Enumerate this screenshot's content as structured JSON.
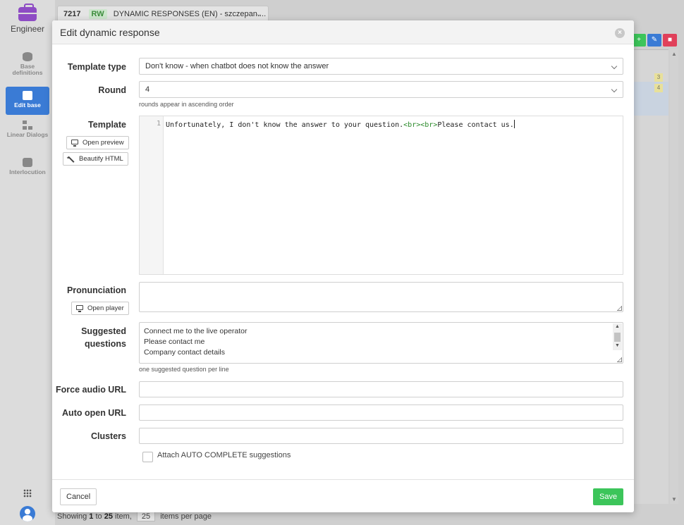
{
  "app": {
    "name": "Engineer",
    "accent": "#3a7bd5",
    "brand_color": "#8e4cc4"
  },
  "sidebar": {
    "items": [
      {
        "label": "Base definitions",
        "icon": "database-icon"
      },
      {
        "label": "Edit base",
        "icon": "table-icon",
        "active": true
      },
      {
        "label": "Linear Dialogs",
        "icon": "flow-icon"
      },
      {
        "label": "Interlocution",
        "icon": "chat-bubble-icon"
      }
    ],
    "bottom_icons": [
      "apps-grid-icon",
      "user-avatar-icon"
    ]
  },
  "background": {
    "base_id": "7217",
    "access": "RW",
    "base_title": "DYNAMIC RESPONSES (EN) - szczepan....",
    "row_badges": [
      "3",
      "4"
    ],
    "pagination": {
      "prefix": "Showing",
      "from": "1",
      "to_word": "to",
      "to": "25",
      "suffix": "item,",
      "per_page": "25",
      "per_page_label": "items per page"
    }
  },
  "modal": {
    "title": "Edit dynamic response",
    "template_type": {
      "label": "Template type",
      "value": "Don't know - when chatbot does not know the answer"
    },
    "round": {
      "label": "Round",
      "value": "4",
      "help": "rounds appear in ascending order"
    },
    "template": {
      "label": "Template",
      "open_preview": "Open preview",
      "beautify": "Beautify HTML",
      "line_number": "1",
      "code_text": "Unfortunately, I don't know the answer to your question.",
      "tag1": "<br>",
      "tag2": "<br>",
      "code_tail": "Please contact us."
    },
    "pronunciation": {
      "label": "Pronunciation",
      "open_player": "Open player",
      "value": ""
    },
    "suggested": {
      "label_line1": "Suggested",
      "label_line2": "questions",
      "lines": [
        "Connect me to the live operator",
        "Please contact me",
        "Company contact details"
      ],
      "help": "one suggested question per line"
    },
    "force_audio": {
      "label": "Force audio URL",
      "value": ""
    },
    "auto_open": {
      "label": "Auto open URL",
      "value": ""
    },
    "clusters": {
      "label": "Clusters",
      "value": ""
    },
    "autocomplete": {
      "label": "Attach AUTO COMPLETE suggestions",
      "checked": false
    },
    "cancel": "Cancel",
    "save": "Save",
    "save_color": "#3cc55a"
  }
}
